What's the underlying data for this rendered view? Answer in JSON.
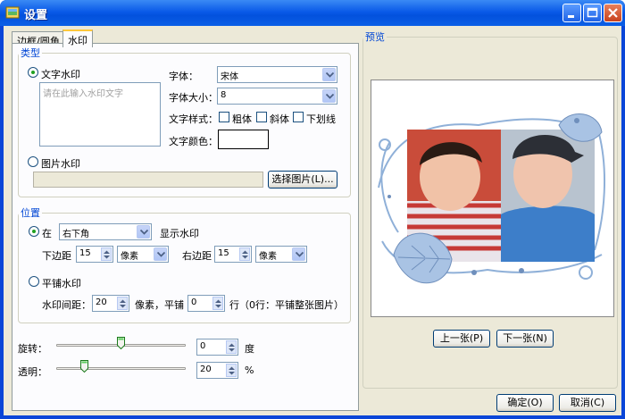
{
  "window": {
    "title": "设置"
  },
  "tabs": [
    {
      "label": "边框/圆角"
    },
    {
      "label": "水印"
    }
  ],
  "type_group": {
    "legend": "类型",
    "text_watermark": "文字水印",
    "text_placeholder": "请在此输入水印文字",
    "font_label": "字体：",
    "font_value": "宋体",
    "font_size_label": "字体大小：",
    "font_size_value": "8",
    "style_label": "文字样式：",
    "bold": "粗体",
    "italic": "斜体",
    "underline": "下划线",
    "color_label": "文字颜色：",
    "image_watermark": "图片水印",
    "choose_image": "选择图片(L)..."
  },
  "position_group": {
    "legend": "位置",
    "at": "在",
    "position_value": "右下角",
    "show_text": "显示水印",
    "bottom_margin_label": "下边距",
    "bottom_margin_value": "15",
    "bottom_unit": "像素",
    "right_margin_label": "右边距",
    "right_margin_value": "15",
    "right_unit": "像素",
    "tile": "平铺水印",
    "spacing_label": "水印间距：",
    "spacing_value": "20",
    "spacing_unit": "像素，平铺",
    "rows_value": "0",
    "rows_note": "行（0行：平铺整张图片）"
  },
  "rotation": {
    "label": "旋转：",
    "value": "0",
    "unit": "度",
    "slider_fraction": 0.5
  },
  "opacity": {
    "label": "透明：",
    "value": "20",
    "unit": "%",
    "slider_fraction": 0.2
  },
  "preview": {
    "legend": "预览",
    "prev": "上一张(P)",
    "next": "下一张(N)"
  },
  "footer": {
    "ok": "确定(O)",
    "cancel": "取消(C)"
  },
  "colors": {
    "title_bar": "#0a5ae8",
    "accent": "#0046d5",
    "text_color_swatch": "#ffffff"
  }
}
